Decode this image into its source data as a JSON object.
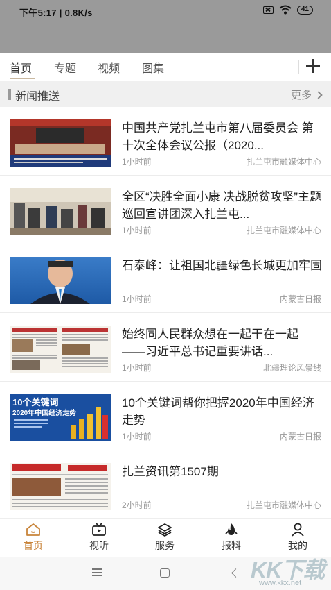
{
  "status_bar": {
    "time_speed": "下午5:17 | 0.8K/s",
    "battery": "41"
  },
  "tabs": [
    {
      "label": "首页",
      "active": true
    },
    {
      "label": "专题",
      "active": false
    },
    {
      "label": "视频",
      "active": false
    },
    {
      "label": "图集",
      "active": false
    }
  ],
  "section": {
    "title": "新闻推送",
    "more_label": "更多"
  },
  "news": [
    {
      "title": "中国共产党扎兰屯市第八届委员会 第十次全体会议公报（2020...",
      "time": "1小时前",
      "source": "扎兰屯市融媒体中心"
    },
    {
      "title": "全区“决胜全面小康 决战脱贫攻坚”主题巡回宣讲团深入扎兰屯...",
      "time": "1小时前",
      "source": "扎兰屯市融媒体中心"
    },
    {
      "title": "石泰峰：让祖国北疆绿色长城更加牢固",
      "time": "1小时前",
      "source": "内蒙古日报"
    },
    {
      "title": "始终同人民群众想在一起干在一起 ——习近平总书记重要讲话...",
      "time": "1小时前",
      "source": "北疆理论风景线"
    },
    {
      "title": "10个关键词帮你把握2020年中国经济走势",
      "time": "1小时前",
      "source": "内蒙古日报"
    },
    {
      "title": "扎兰资讯第1507期",
      "time": "2小时前",
      "source": "扎兰屯市融媒体中心"
    }
  ],
  "thumb_text": {
    "keywords_banner": "10个关键词",
    "keywords_sub": "2020年中国经济走势"
  },
  "bottom_nav": [
    {
      "label": "首页",
      "icon": "home-icon",
      "active": true
    },
    {
      "label": "视听",
      "icon": "tv-icon",
      "active": false
    },
    {
      "label": "服务",
      "icon": "layers-icon",
      "active": false
    },
    {
      "label": "报料",
      "icon": "fire-icon",
      "active": false
    },
    {
      "label": "我的",
      "icon": "user-icon",
      "active": false
    }
  ],
  "watermark": {
    "brand": "KK下载",
    "url": "www.kkx.net"
  },
  "colors": {
    "status_bg": "#9a9a9a",
    "accent": "#c8843a",
    "section_bg": "#f0f0f0"
  }
}
